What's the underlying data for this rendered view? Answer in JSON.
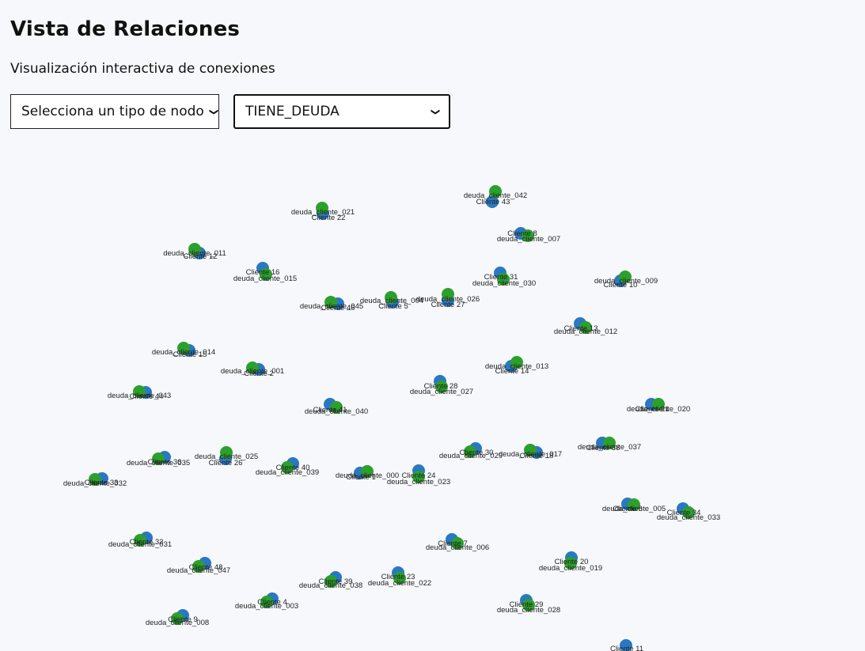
{
  "page": {
    "title": "Vista de Relaciones",
    "subtitle": "Visualización interactiva de conexiones"
  },
  "filters": {
    "node_type_select": "Selecciona un tipo de nodo",
    "relation_select": "TIENE_DEUDA"
  },
  "colors": {
    "cliente_node": "#2a78c2",
    "deuda_node": "#2ca02c",
    "edge": "#9a9a9a"
  },
  "graph": {
    "nodes": [
      {
        "id": "c22",
        "label": "Cliente 22",
        "kind": "cliente"
      },
      {
        "id": "d021",
        "label": "deuda_cliente_021",
        "kind": "deuda"
      },
      {
        "id": "c43",
        "label": "Cliente 43",
        "kind": "cliente"
      },
      {
        "id": "d042",
        "label": "deuda_cliente_042",
        "kind": "deuda"
      },
      {
        "id": "c8",
        "label": "Cliente 8",
        "kind": "cliente"
      },
      {
        "id": "d007",
        "label": "deuda_cliente_007",
        "kind": "deuda"
      },
      {
        "id": "c12",
        "label": "Cliente 12",
        "kind": "cliente"
      },
      {
        "id": "d011",
        "label": "deuda_cliente_011",
        "kind": "deuda"
      },
      {
        "id": "c16",
        "label": "Cliente 16",
        "kind": "cliente"
      },
      {
        "id": "d015",
        "label": "deuda_cliente_015",
        "kind": "deuda"
      },
      {
        "id": "c31",
        "label": "Cliente 31",
        "kind": "cliente"
      },
      {
        "id": "d030",
        "label": "deuda_cliente_030",
        "kind": "deuda"
      },
      {
        "id": "c10",
        "label": "Cliente 10",
        "kind": "cliente"
      },
      {
        "id": "d009",
        "label": "deuda_cliente_009",
        "kind": "deuda"
      },
      {
        "id": "c46",
        "label": "Cliente 46",
        "kind": "cliente"
      },
      {
        "id": "d045",
        "label": "deuda_cliente_045",
        "kind": "deuda"
      },
      {
        "id": "c5",
        "label": "Cliente 5",
        "kind": "cliente"
      },
      {
        "id": "d004",
        "label": "deuda_cliente_004",
        "kind": "deuda"
      },
      {
        "id": "c27",
        "label": "Cliente 27",
        "kind": "cliente"
      },
      {
        "id": "d026",
        "label": "deuda_cliente_026",
        "kind": "deuda"
      },
      {
        "id": "c13",
        "label": "Cliente 13",
        "kind": "cliente"
      },
      {
        "id": "d012",
        "label": "deuda_cliente_012",
        "kind": "deuda"
      },
      {
        "id": "c15",
        "label": "Cliente 15",
        "kind": "cliente"
      },
      {
        "id": "d014",
        "label": "deuda_cliente_014",
        "kind": "deuda"
      },
      {
        "id": "c2",
        "label": "Cliente 2",
        "kind": "cliente"
      },
      {
        "id": "d001",
        "label": "deuda_cliente_001",
        "kind": "deuda"
      },
      {
        "id": "c14",
        "label": "Cliente 14",
        "kind": "cliente"
      },
      {
        "id": "d013",
        "label": "deuda_cliente_013",
        "kind": "deuda"
      },
      {
        "id": "c28",
        "label": "Cliente 28",
        "kind": "cliente"
      },
      {
        "id": "d027",
        "label": "deuda_cliente_027",
        "kind": "deuda"
      },
      {
        "id": "c44",
        "label": "Cliente 44",
        "kind": "cliente"
      },
      {
        "id": "d043",
        "label": "deuda_cliente_043",
        "kind": "deuda"
      },
      {
        "id": "c41",
        "label": "Cliente 41",
        "kind": "cliente"
      },
      {
        "id": "d040",
        "label": "deuda_cliente_040",
        "kind": "deuda"
      },
      {
        "id": "c21",
        "label": "Cliente 21",
        "kind": "cliente"
      },
      {
        "id": "d020",
        "label": "deuda_cliente_020",
        "kind": "deuda"
      },
      {
        "id": "c36",
        "label": "Cliente 36",
        "kind": "cliente"
      },
      {
        "id": "d035",
        "label": "deuda_cliente_035",
        "kind": "deuda"
      },
      {
        "id": "c26",
        "label": "Cliente 26",
        "kind": "cliente"
      },
      {
        "id": "d025",
        "label": "deuda_cliente_025",
        "kind": "deuda"
      },
      {
        "id": "c40",
        "label": "Cliente 40",
        "kind": "cliente"
      },
      {
        "id": "d039",
        "label": "deuda_cliente_039",
        "kind": "deuda"
      },
      {
        "id": "c30",
        "label": "Cliente 30",
        "kind": "cliente"
      },
      {
        "id": "d029",
        "label": "deuda_cliente_029",
        "kind": "deuda"
      },
      {
        "id": "c18",
        "label": "Cliente 18",
        "kind": "cliente"
      },
      {
        "id": "d017",
        "label": "deuda_cliente_017",
        "kind": "deuda"
      },
      {
        "id": "c38",
        "label": "Cliente 38",
        "kind": "cliente"
      },
      {
        "id": "d037",
        "label": "deuda_cliente_037",
        "kind": "deuda"
      },
      {
        "id": "c33",
        "label": "Cliente 33",
        "kind": "cliente"
      },
      {
        "id": "d032",
        "label": "deuda_cliente_032",
        "kind": "deuda"
      },
      {
        "id": "c1",
        "label": "Cliente 1",
        "kind": "cliente"
      },
      {
        "id": "d000",
        "label": "deuda_cliente_000",
        "kind": "deuda"
      },
      {
        "id": "c24",
        "label": "Cliente 24",
        "kind": "cliente"
      },
      {
        "id": "d023",
        "label": "deuda_cliente_023",
        "kind": "deuda"
      },
      {
        "id": "c6",
        "label": "Cliente 6",
        "kind": "cliente"
      },
      {
        "id": "d005",
        "label": "deuda_cliente_005",
        "kind": "deuda"
      },
      {
        "id": "c34",
        "label": "Cliente 34",
        "kind": "cliente"
      },
      {
        "id": "d033",
        "label": "deuda_cliente_033",
        "kind": "deuda"
      },
      {
        "id": "c32",
        "label": "Cliente 32",
        "kind": "cliente"
      },
      {
        "id": "d031",
        "label": "deuda_cliente_031",
        "kind": "deuda"
      },
      {
        "id": "c7",
        "label": "Cliente 7",
        "kind": "cliente"
      },
      {
        "id": "d006",
        "label": "deuda_cliente_006",
        "kind": "deuda"
      },
      {
        "id": "c48",
        "label": "Cliente 48",
        "kind": "cliente"
      },
      {
        "id": "d047",
        "label": "deuda_cliente_047",
        "kind": "deuda"
      },
      {
        "id": "c20",
        "label": "Cliente 20",
        "kind": "cliente"
      },
      {
        "id": "d019",
        "label": "deuda_cliente_019",
        "kind": "deuda"
      },
      {
        "id": "c39",
        "label": "Cliente 39",
        "kind": "cliente"
      },
      {
        "id": "d038",
        "label": "deuda_cliente_038",
        "kind": "deuda"
      },
      {
        "id": "c23",
        "label": "Cliente 23",
        "kind": "cliente"
      },
      {
        "id": "d022",
        "label": "deuda_cliente_022",
        "kind": "deuda"
      },
      {
        "id": "c4",
        "label": "Cliente 4",
        "kind": "cliente"
      },
      {
        "id": "d003",
        "label": "deuda_cliente_003",
        "kind": "deuda"
      },
      {
        "id": "c29",
        "label": "Cliente 29",
        "kind": "cliente"
      },
      {
        "id": "d028",
        "label": "deuda_cliente_028",
        "kind": "deuda"
      },
      {
        "id": "c9",
        "label": "Cliente 9",
        "kind": "cliente"
      },
      {
        "id": "d008",
        "label": "deuda_cliente_008",
        "kind": "deuda"
      },
      {
        "id": "c11",
        "label": "Cliente 11",
        "kind": "cliente"
      }
    ]
  }
}
